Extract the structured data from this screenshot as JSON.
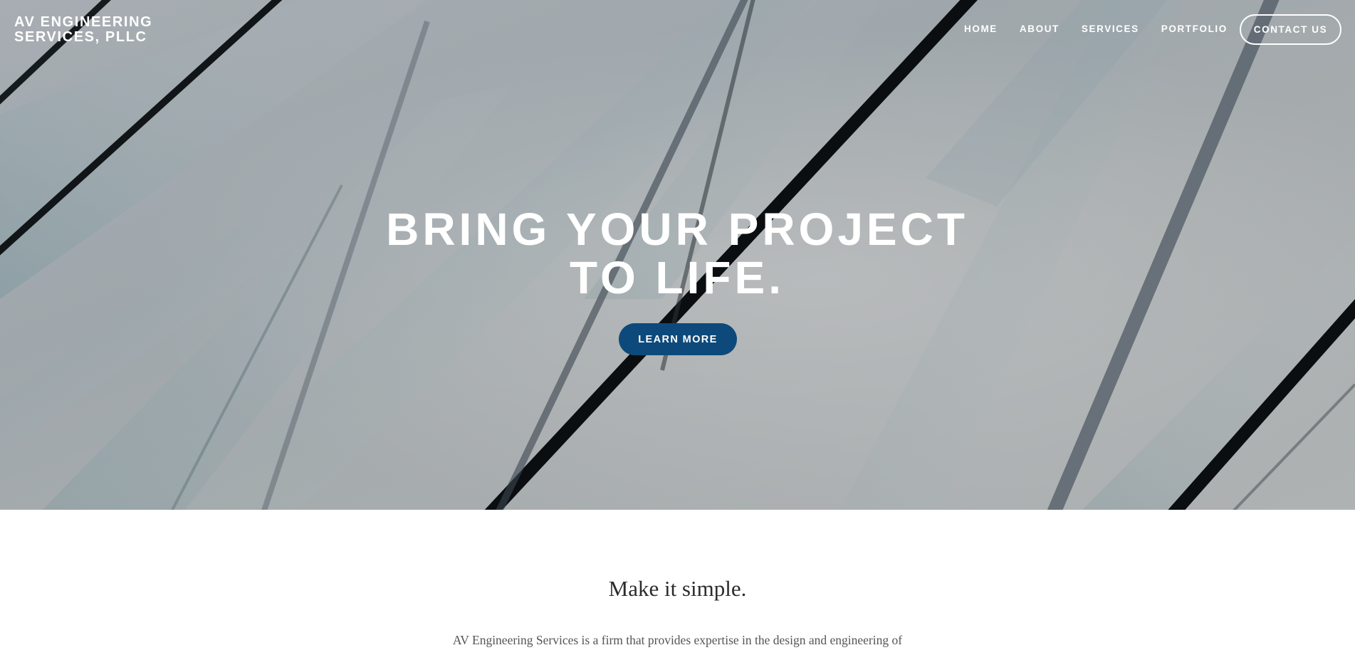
{
  "site": {
    "title_line1": "AV ENGINEERING",
    "title_line2": "SERVICES, PLLC"
  },
  "nav": {
    "items": [
      {
        "label": "HOME"
      },
      {
        "label": "ABOUT"
      },
      {
        "label": "SERVICES"
      },
      {
        "label": "PORTFOLIO"
      }
    ],
    "contact_label": "CONTACT US"
  },
  "hero": {
    "heading_line1": "BRING YOUR PROJECT",
    "heading_line2": "TO LIFE.",
    "button_label": "LEARN MORE",
    "button_color": "#0d4a7b"
  },
  "intro": {
    "heading": "Make it simple.",
    "text": "AV Engineering Services is a firm that provides expertise in the design and engineering of"
  }
}
